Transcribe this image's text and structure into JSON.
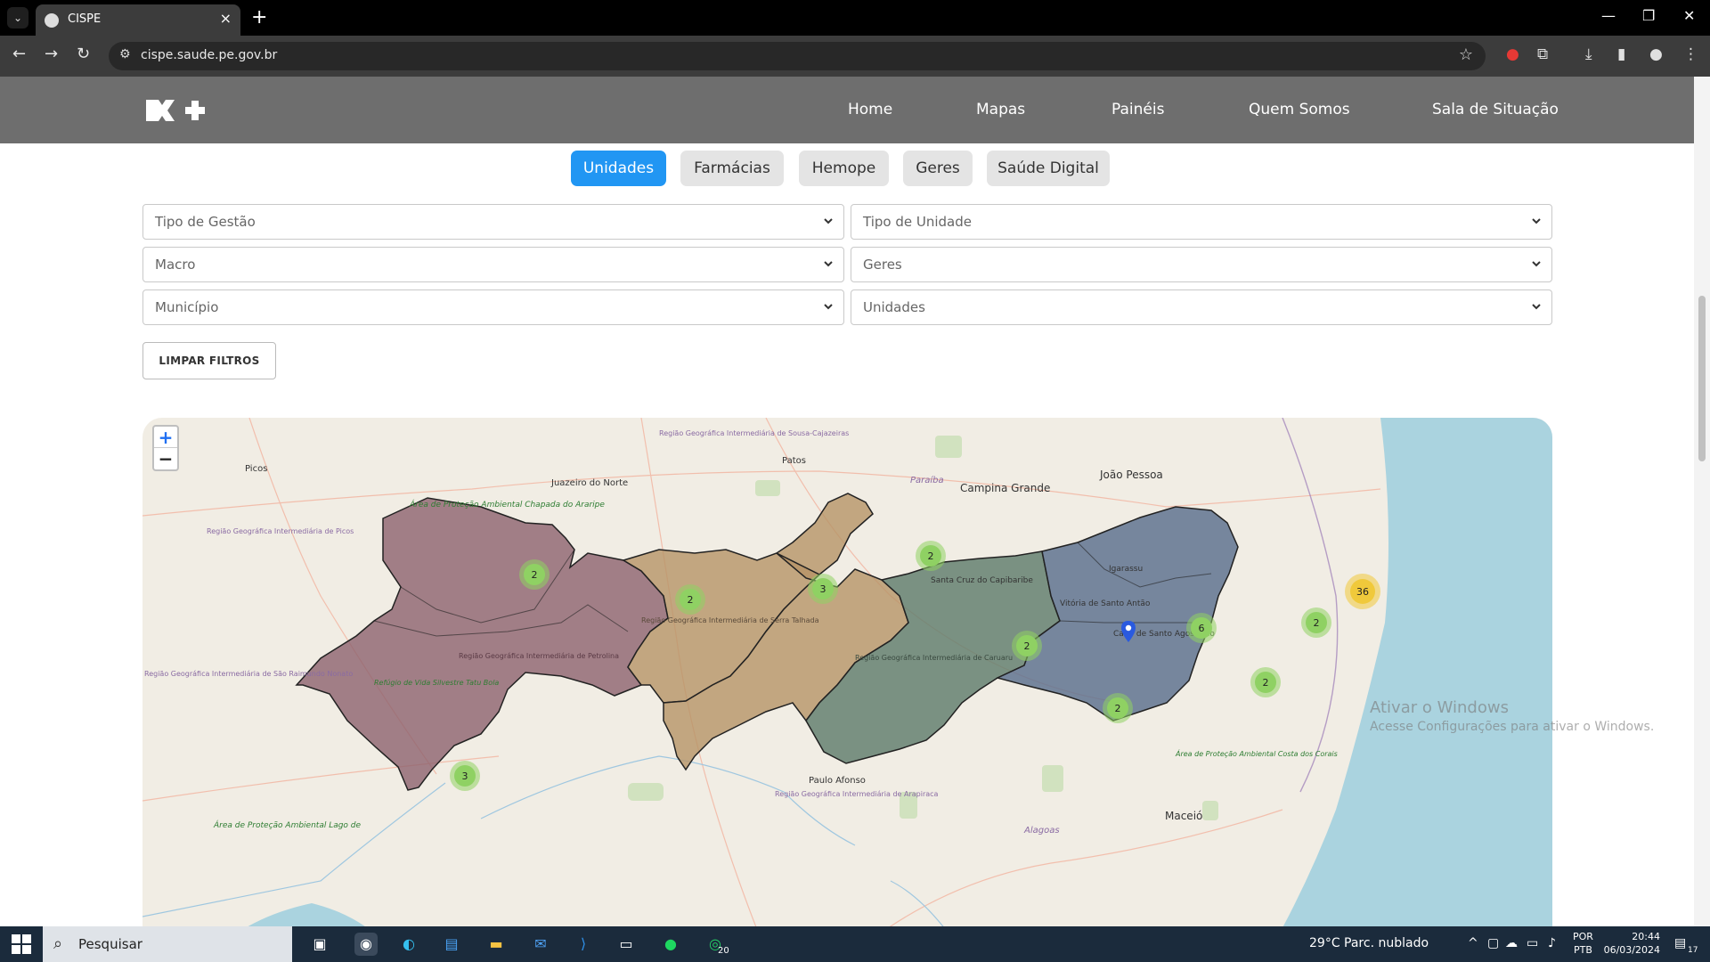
{
  "browser": {
    "tab_title": "CISPE",
    "url": "cispe.saude.pe.gov.br"
  },
  "site": {
    "nav": [
      "Home",
      "Mapas",
      "Painéis",
      "Quem Somos",
      "Sala de Situação"
    ]
  },
  "filter_tabs": [
    {
      "label": "Unidades",
      "active": true
    },
    {
      "label": "Farmácias",
      "active": false
    },
    {
      "label": "Hemope",
      "active": false
    },
    {
      "label": "Geres",
      "active": false
    },
    {
      "label": "Saúde Digital",
      "active": false
    }
  ],
  "filters": {
    "tipo_gestao": "Tipo de Gestão",
    "tipo_unidade": "Tipo de Unidade",
    "macro": "Macro",
    "geres": "Geres",
    "municipio": "Município",
    "unidades": "Unidades",
    "clear_label": "LIMPAR FILTROS"
  },
  "map": {
    "zoom_in": "+",
    "zoom_out": "−",
    "colors": {
      "macro_sertao": "#8a5f6b",
      "macro_agreste_sertao": "#b69466",
      "macro_agreste": "#5f7d6c",
      "macro_metropolitana": "#5a6f8e",
      "ocean": "#aad3df",
      "cluster": "#8fd163",
      "cluster_large": "#f0c93b"
    },
    "clusters": [
      {
        "count": "2"
      },
      {
        "count": "2"
      },
      {
        "count": "3"
      },
      {
        "count": "2"
      },
      {
        "count": "2"
      },
      {
        "count": "6"
      },
      {
        "count": "2"
      },
      {
        "count": "36"
      },
      {
        "count": "2"
      },
      {
        "count": "2"
      },
      {
        "count": "3"
      }
    ],
    "place_labels": {
      "picos": "Picos",
      "juazeiro": "Juazeiro do Norte",
      "patos": "Patos",
      "paraiba": "Paraíba",
      "campina": "Campina Grande",
      "joao_pessoa": "João Pessoa",
      "paulo_afonso": "Paulo Afonso",
      "maceio": "Maceió",
      "alagoas": "Alagoas",
      "igarassu": "Igarassu",
      "santa_cruz": "Santa Cruz do Capibaribe",
      "vitoria": "Vitória de Santo Antão",
      "cabo": "Cabo de Santo Agostinho",
      "arapiraca": "Região Geográfica Intermediária de Arapiraca",
      "sousa": "Região Geográfica Intermediária de Sousa-Cajazeiras",
      "picos_reg": "Região Geográfica Intermediária de Picos",
      "sao_raimundo": "Região Geográfica Intermediária de São Raimundo Nonato",
      "serra_talhada": "Região Geográfica Intermediária de Serra Talhada",
      "petrolina": "Região Geográfica Intermediária de Petrolina",
      "caruaru": "Região Geográfica Intermediária de Caruaru",
      "araripe": "Área de Proteção Ambiental Chapada do Araripe",
      "tatu_bola": "Refúgio de Vida Silvestre Tatu Bola",
      "costa_corais": "Área de Proteção Ambiental Costa dos Corais",
      "lago": "Área de Proteção Ambiental Lago de"
    }
  },
  "watermark": {
    "title": "Ativar o Windows",
    "subtitle": "Acesse Configurações para ativar o Windows."
  },
  "taskbar": {
    "search_placeholder": "Pesquisar",
    "whatsapp_badge": "20",
    "weather": "29°C  Parc. nublado",
    "lang_top": "POR",
    "lang_bottom": "PTB",
    "time": "20:44",
    "date": "06/03/2024",
    "notif_count": "17"
  }
}
